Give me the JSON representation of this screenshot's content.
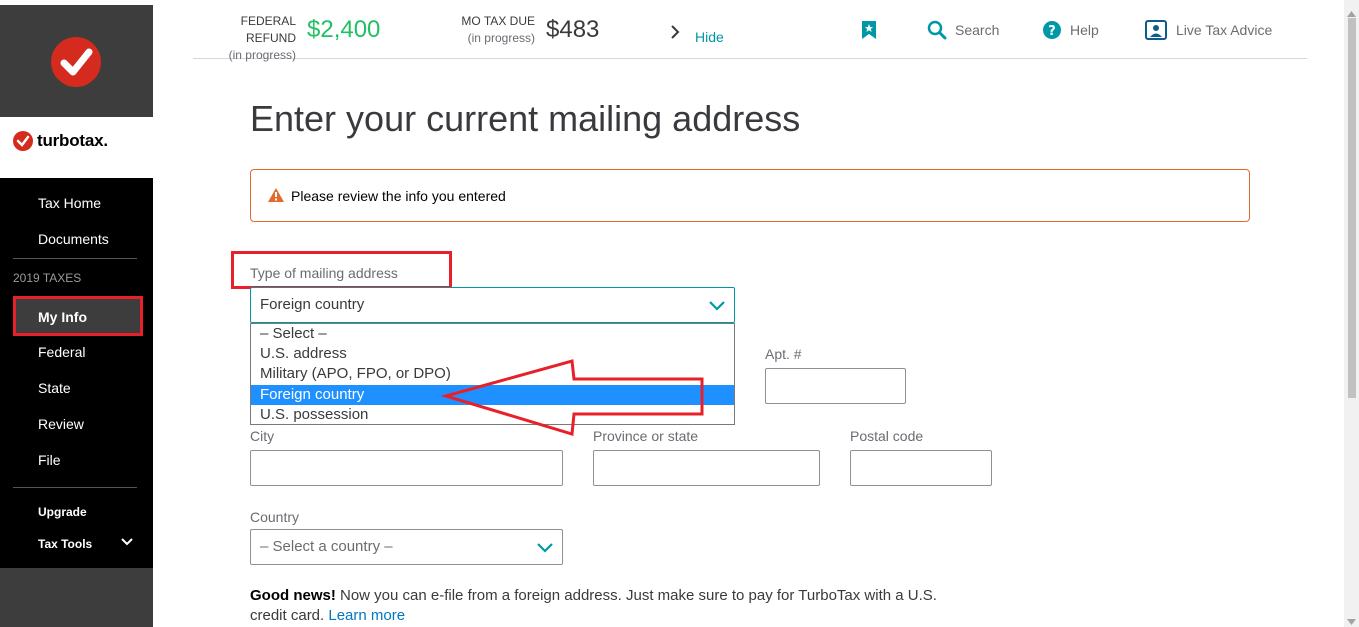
{
  "sidebar": {
    "brand": "turbotax.",
    "nav_top": [
      "Tax Home",
      "Documents"
    ],
    "section": "2019 TAXES",
    "active": "My Info",
    "nav_main": [
      "Federal",
      "State",
      "Review",
      "File"
    ],
    "upgrade": "Upgrade",
    "tax_tools": "Tax Tools"
  },
  "topbar": {
    "federal_label": "FEDERAL REFUND",
    "federal_sub": "(in progress)",
    "federal_value": "$2,400",
    "state_label": "MO TAX DUE",
    "state_sub": "(in progress)",
    "state_value": "$483",
    "hide": "Hide",
    "search": "Search",
    "help": "Help",
    "live": "Live Tax Advice"
  },
  "main": {
    "title": "Enter your current mailing address",
    "alert": "Please review the info you entered",
    "address_type_label": "Type of mailing address",
    "address_type_value": "Foreign country",
    "options": [
      "– Select –",
      "U.S. address",
      "Military (APO, FPO, or DPO)",
      "Foreign country",
      "U.S. possession"
    ],
    "selected_option_index": 3,
    "apt_label": "Apt. #",
    "city_label": "City",
    "province_label": "Province or state",
    "postal_label": "Postal code",
    "country_label": "Country",
    "country_placeholder": "– Select a country –",
    "goodnews_bold": "Good news!",
    "goodnews_text": " Now you can e-file from a foreign address. Just make sure to pay for TurboTax with a U.S. credit card. ",
    "learn_more": "Learn more"
  },
  "colors": {
    "accent": "#0098a6",
    "refund_green": "#21c064",
    "annotation_red": "#e8202a",
    "alert_orange": "#e26a2c",
    "selected_blue": "#1e90ff"
  }
}
